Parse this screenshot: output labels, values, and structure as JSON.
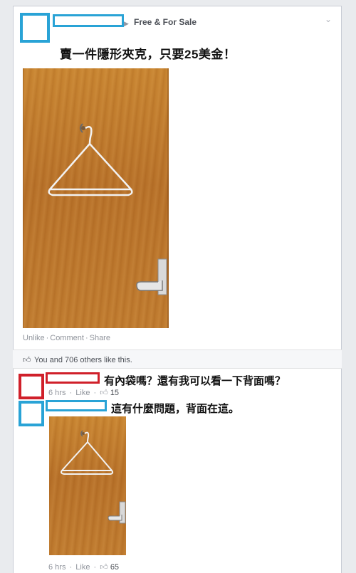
{
  "post": {
    "group_name": "Free & For Sale",
    "text": "賣一件隱形夾克，只要25美金！",
    "actions": [
      "Unlike",
      "Comment",
      "Share"
    ]
  },
  "likes_summary": "You and 706 others like this.",
  "comments": [
    {
      "text": "有內袋嗎？還有我可以看一下背面嗎？",
      "time": "6 hrs",
      "like_label": "Like",
      "like_count": "15"
    },
    {
      "text": "這有什麼問題，背面在這。",
      "time": "6 hrs",
      "like_label": "Like",
      "like_count": "65"
    }
  ],
  "icons": {
    "thumb": "thumbs-up-icon",
    "chevron": "chevron-down-icon",
    "arrow": "triangle-right-icon"
  },
  "colors": {
    "censor_blue": "#29a3d6",
    "censor_red": "#d0202a"
  }
}
